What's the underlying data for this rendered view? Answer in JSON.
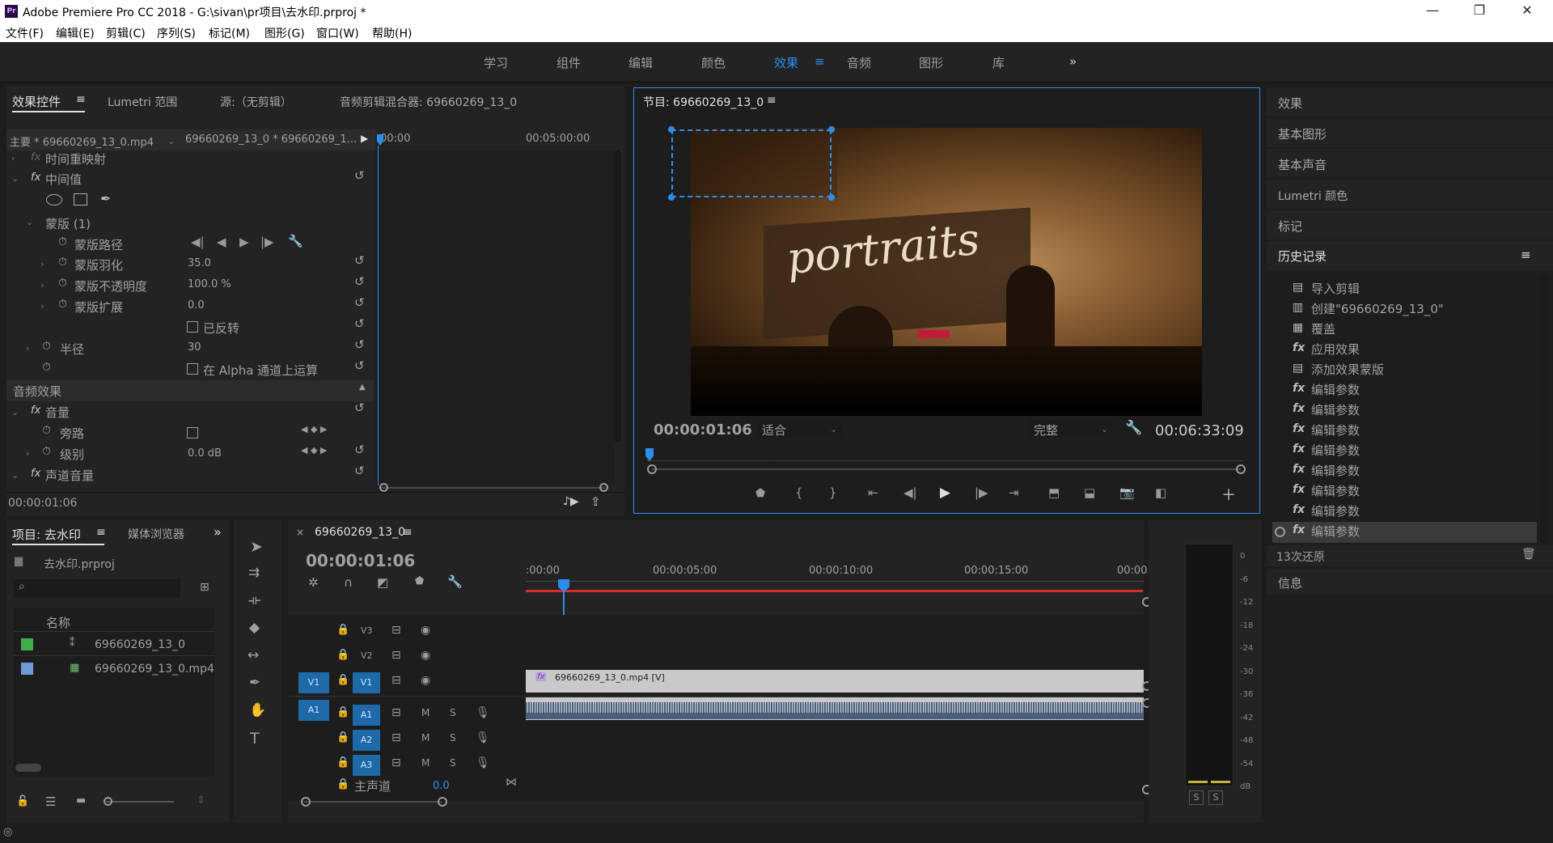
{
  "window": {
    "logo": "Pr",
    "title": "Adobe Premiere Pro CC 2018 - G:\\sivan\\pr项目\\去水印.prproj *",
    "minimize": "—",
    "restore": "❐",
    "close": "✕"
  },
  "menu": [
    "文件(F)",
    "编辑(E)",
    "剪辑(C)",
    "序列(S)",
    "标记(M)",
    "图形(G)",
    "窗口(W)",
    "帮助(H)"
  ],
  "workspaces": [
    "学习",
    "组件",
    "编辑",
    "颜色",
    "效果",
    "音频",
    "图形",
    "库"
  ],
  "workspace_active": "效果",
  "workspace_more": "»",
  "effect_controls": {
    "tabs": [
      "效果控件",
      "Lumetri 范围",
      "源:（无剪辑）",
      "音频剪辑混合器: 69660269_13_0"
    ],
    "master": "主要 * 69660269_13_0.mp4",
    "sequence": "69660269_13_0 * 69660269_1...",
    "time_start": "00:00",
    "time_end": "00:05:00:00",
    "rows": {
      "time_remap": "时间重映射",
      "opacity_fx": "中间值",
      "mask": "蒙版 (1)",
      "mask_path": "蒙版路径",
      "mask_feather": "蒙版羽化",
      "mask_feather_val": "35.0",
      "mask_opacity": "蒙版不透明度",
      "mask_opacity_val": "100.0 %",
      "mask_expansion": "蒙版扩展",
      "mask_expansion_val": "0.0",
      "inverted": "已反转",
      "radius": "半径",
      "radius_val": "30",
      "alpha": "在 Alpha 通道上运算",
      "audio_effects": "音频效果",
      "volume": "音量",
      "bypass": "旁路",
      "level": "级别",
      "level_val": "0.0 dB",
      "channel_volume": "声道音量",
      "cut_row": "声道"
    },
    "fx_label": "fx",
    "timecode": "00:00:01:06"
  },
  "program": {
    "title": "节目: 69660269_13_0",
    "timecode": "00:00:01:06",
    "fit": "适合",
    "quality": "完整",
    "duration": "00:06:33:09",
    "video_text": "portraits"
  },
  "right_panels": [
    "效果",
    "基本图形",
    "基本声音",
    "Lumetri 颜色",
    "标记",
    "历史记录"
  ],
  "history": {
    "items": [
      {
        "label": "导入剪辑",
        "icon": "import"
      },
      {
        "label": "创建\"69660269_13_0\"",
        "icon": "sequence"
      },
      {
        "label": "覆盖",
        "icon": "overwrite"
      },
      {
        "label": "应用效果",
        "icon": "fx"
      },
      {
        "label": "添加效果蒙版",
        "icon": "mask"
      },
      {
        "label": "编辑参数",
        "icon": "fx"
      },
      {
        "label": "编辑参数",
        "icon": "fx"
      },
      {
        "label": "编辑参数",
        "icon": "fx"
      },
      {
        "label": "编辑参数",
        "icon": "fx"
      },
      {
        "label": "编辑参数",
        "icon": "fx"
      },
      {
        "label": "编辑参数",
        "icon": "fx"
      },
      {
        "label": "编辑参数",
        "icon": "fx"
      },
      {
        "label": "编辑参数",
        "icon": "fx"
      }
    ],
    "undo_count": "13次还原",
    "info": "信息"
  },
  "project": {
    "tab": "项目: 去水印",
    "tab2": "媒体浏览器",
    "file": "去水印.prproj",
    "name_header": "名称",
    "items": [
      {
        "name": "69660269_13_0",
        "color": "#3fae49"
      },
      {
        "name": "69660269_13_0.mp4",
        "color": "#6f9ad6"
      }
    ]
  },
  "timeline": {
    "tab": "69660269_13_0",
    "timecode": "00:00:01:06",
    "ruler": [
      ":00:00",
      "00:00:05:00",
      "00:00:10:00",
      "00:00:15:00",
      "00:00"
    ],
    "tracks_video": [
      "V3",
      "V2",
      "V1"
    ],
    "tracks_audio": [
      "A1",
      "A2",
      "A3"
    ],
    "source_v": "V1",
    "source_a": "A1",
    "master": "主声道",
    "master_val": "0.0",
    "clip_video": "69660269_13_0.mp4 [V]",
    "m": "M",
    "s": "S"
  },
  "meter": {
    "scale": [
      "0",
      "-6",
      "-12",
      "-18",
      "-24",
      "-30",
      "-36",
      "-42",
      "-48",
      "-54",
      "dB"
    ],
    "solo": "S"
  }
}
